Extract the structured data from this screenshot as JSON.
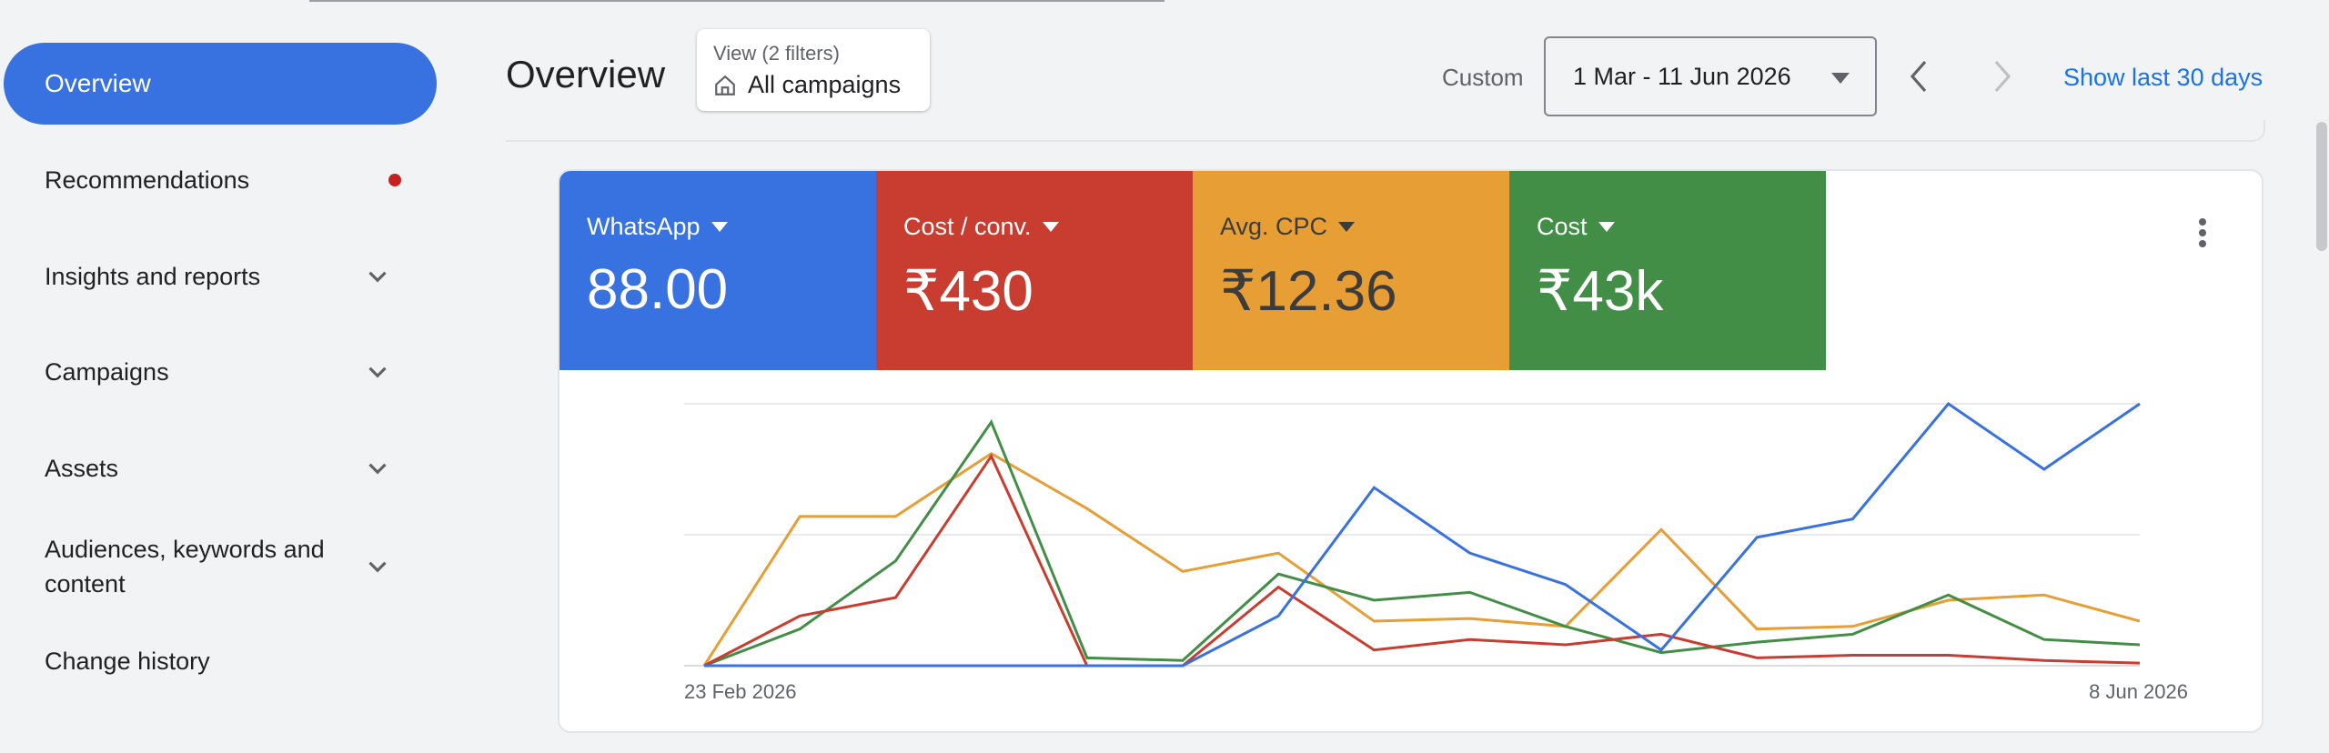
{
  "sidebar": {
    "items": [
      {
        "label": "Overview"
      },
      {
        "label": "Recommendations"
      },
      {
        "label": "Insights and reports"
      },
      {
        "label": "Campaigns"
      },
      {
        "label": "Assets"
      },
      {
        "label": "Audiences, keywords and content"
      },
      {
        "label": "Change history"
      }
    ]
  },
  "header": {
    "title": "Overview",
    "view_filter_small": "View (2 filters)",
    "view_filter_main": "All campaigns",
    "custom_label": "Custom",
    "date_range": "1 Mar - 11 Jun 2026",
    "show_last": "Show last 30 days"
  },
  "metrics": [
    {
      "label": "WhatsApp",
      "value": "88.00",
      "color": "#3772e0"
    },
    {
      "label": "Cost / conv.",
      "value": "₹430",
      "color": "#c93d30"
    },
    {
      "label": "Avg. CPC",
      "value": "₹12.36",
      "color": "#e69e35"
    },
    {
      "label": "Cost",
      "value": "₹43k",
      "color": "#438e46"
    }
  ],
  "chart_data": {
    "type": "line",
    "x_start_label": "23 Feb 2026",
    "x_end_label": "8 Jun 2026",
    "points": 16,
    "grid": true,
    "series": [
      {
        "color": "#e69e35",
        "values": [
          0,
          57,
          57,
          81,
          60,
          36,
          43,
          17,
          18,
          15,
          52,
          14,
          15,
          25,
          27,
          17
        ]
      },
      {
        "color": "#438e46",
        "values": [
          0,
          14,
          40,
          93,
          3,
          2,
          35,
          25,
          28,
          15,
          5,
          9,
          12,
          27,
          10,
          8
        ]
      },
      {
        "color": "#c93d30",
        "values": [
          0,
          19,
          26,
          80,
          0,
          0,
          30,
          6,
          10,
          8,
          12,
          3,
          4,
          4,
          2,
          1
        ]
      },
      {
        "color": "#3772e0",
        "values": [
          0,
          0,
          0,
          0,
          0,
          0,
          19,
          68,
          43,
          31,
          6,
          49,
          56,
          100,
          75,
          100
        ]
      }
    ]
  }
}
